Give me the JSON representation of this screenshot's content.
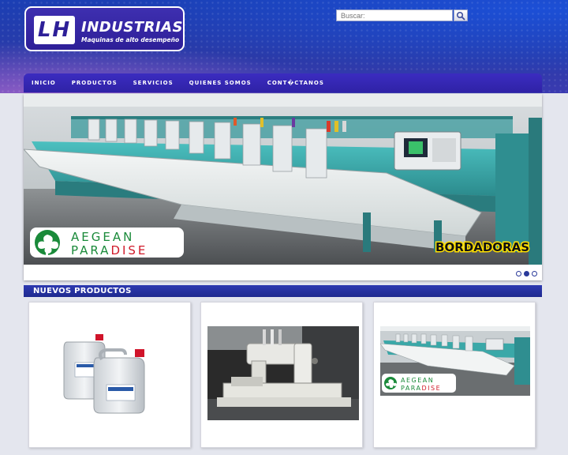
{
  "brand": {
    "logo_mark": "LH",
    "name": "INDUSTRIAS",
    "tagline": "Maquinas de alto desempeño"
  },
  "search": {
    "placeholder": "Buscar:",
    "button_icon": "search-icon"
  },
  "nav": {
    "items": [
      "INICIO",
      "PRODUCTOS",
      "SERVICIOS",
      "QUIENES SOMOS",
      "CONT�CTANOS"
    ]
  },
  "slider": {
    "badge_word1": "AEGEAN",
    "badge_word2_part1": "PARA",
    "badge_word2_part2": "DISE",
    "caption": "BORDADORAS",
    "dots": 3,
    "active_dot": 2
  },
  "section": {
    "title": "NUEVOS PRODUCTOS"
  },
  "products": [
    {
      "image": "chemical-jugs-image"
    },
    {
      "image": "sewing-machine-image"
    },
    {
      "image": "embroidery-machine-image",
      "badge_word1": "AEGEAN",
      "badge_word2_part1": "PARA",
      "badge_word2_part2": "DISE"
    }
  ],
  "colors": {
    "brand_blue": "#2d22a6",
    "machine_teal": "#3aa8a8",
    "badge_green": "#1a8a3a",
    "badge_red": "#d01a2a"
  }
}
